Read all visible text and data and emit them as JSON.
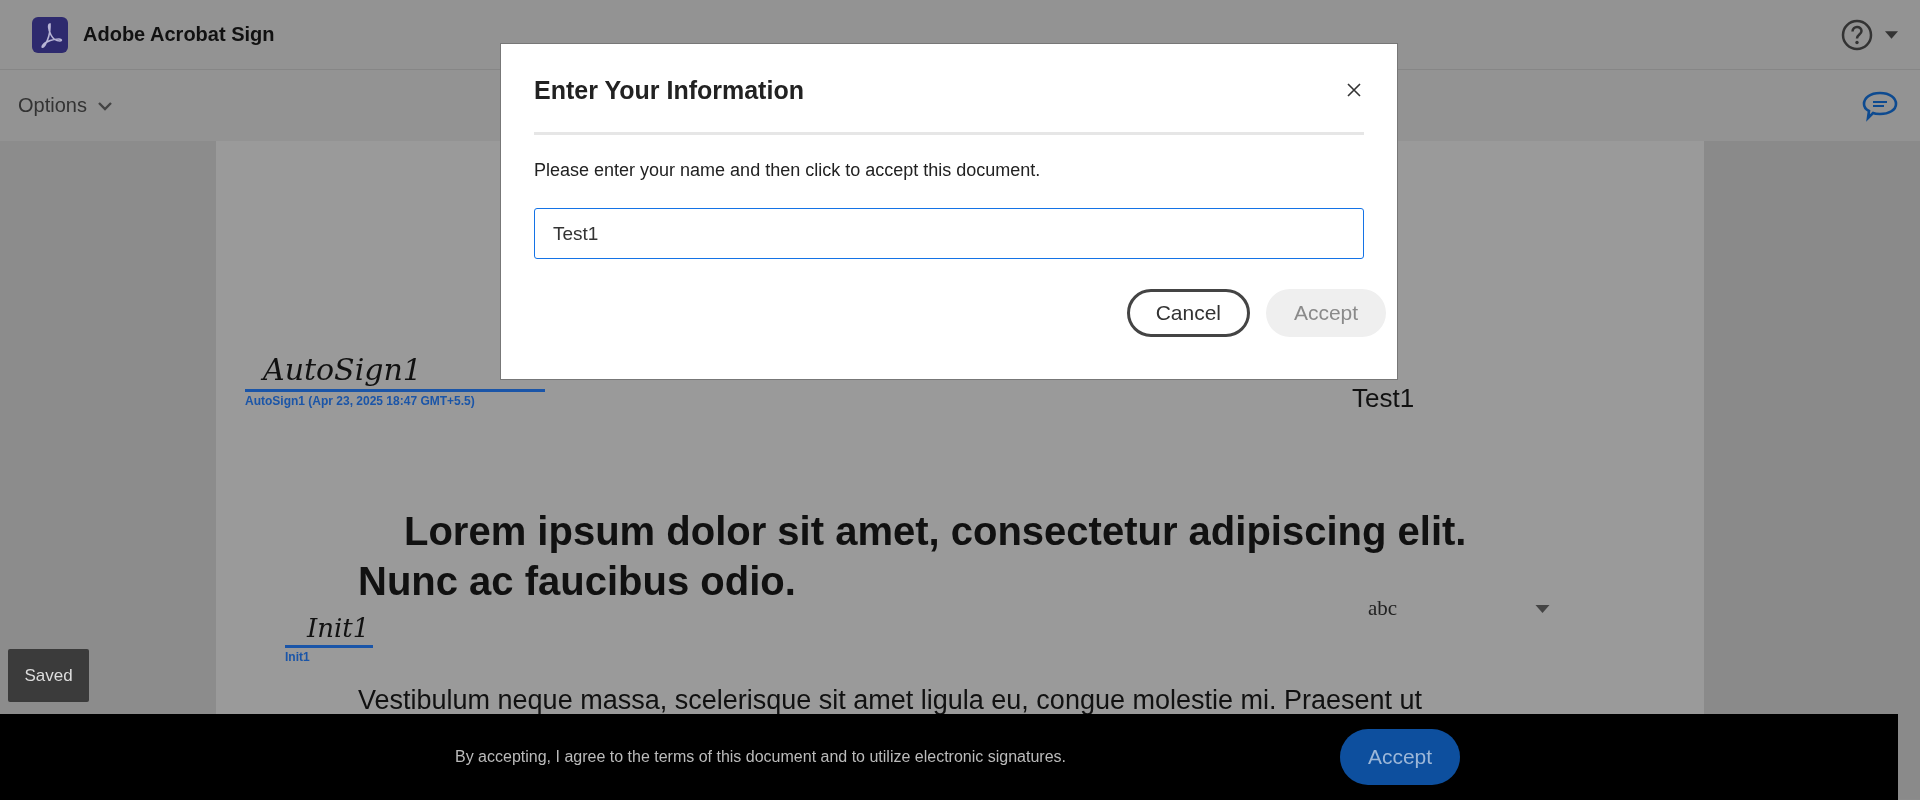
{
  "header": {
    "app_title": "Adobe Acrobat Sign"
  },
  "toolbar": {
    "options_label": "Options"
  },
  "document": {
    "signature": {
      "text": "AutoSign1",
      "caption": "AutoSign1 (Apr 23, 2025 18:47 GMT+5.5)"
    },
    "name_value": "Test1",
    "heading": "Lorem ipsum dolor sit amet, consectetur adipiscing elit. Nunc ac faucibus odio.",
    "dropdown_value": "abc",
    "initials": {
      "text": "Init1",
      "caption": "Init1"
    },
    "paragraph": "Vestibulum neque massa, scelerisque sit amet ligula eu, congue molestie mi. Praesent ut"
  },
  "save_status": "Saved",
  "dialog": {
    "title": "Enter Your Information",
    "message": "Please enter your name and then click to accept this document.",
    "name_input": {
      "value": "Test1"
    },
    "buttons": [
      {
        "label": "Cancel",
        "kind": "secondary",
        "disabled": false
      },
      {
        "label": "Accept",
        "kind": "primary",
        "disabled": true
      }
    ]
  },
  "footer": {
    "message": "By accepting, I agree to the terms of this document and to utilize electronic signatures.",
    "accept_label": "Accept"
  }
}
